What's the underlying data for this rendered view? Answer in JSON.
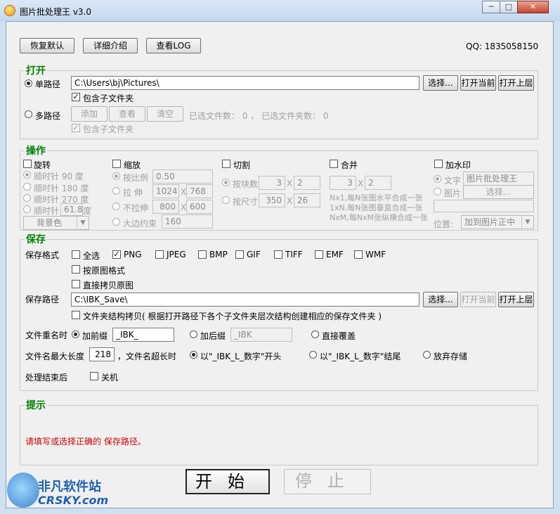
{
  "window": {
    "title": "图片批处理王 v3.0",
    "min": "─",
    "max": "□",
    "close": "✕"
  },
  "toolbar": {
    "reset": "恢复默认",
    "details": "详细介绍",
    "log": "查看LOG",
    "qq": "QQ: 1835058150"
  },
  "open": {
    "title": "打开",
    "single_path_label": "单路径",
    "single_path_value": "C:\\Users\\bj\\Pictures\\",
    "choose": "选择...",
    "open_current": "打开当前",
    "open_parent": "打开上层",
    "include_sub": "包含子文件夹",
    "multi_path_label": "多路径",
    "add": "添加",
    "view": "查看",
    "clear": "清空",
    "files_selected": "已选文件数：  0  ，  已选文件夹数：  0",
    "include_sub2": "包含子文件夹"
  },
  "ops": {
    "title": "操作",
    "rotate": {
      "label": "旋转",
      "cw90": "顺时针   90  度",
      "cw180": "顺时针  180  度",
      "cw270": "顺时针  270  度",
      "cw": "顺时针",
      "custom": "61.8",
      "deg": "度",
      "bg": "背景色"
    },
    "scale": {
      "label": "缩放",
      "ratio": "按比例",
      "ratio_val": "0.50",
      "stretch": "拉   伸",
      "w1": "1024",
      "h1": "768",
      "nostretch": "不拉伸",
      "w2": "800",
      "h2": "600",
      "x": "X",
      "edge": "大边约束",
      "edge_val": "160"
    },
    "cut": {
      "label": "切割",
      "by_count": "按块数",
      "c1": "3",
      "c2": "2",
      "by_size": "按尺寸",
      "s1": "350",
      "s2": "26",
      "x": "X"
    },
    "merge": {
      "label": "合并",
      "m1": "3",
      "m2": "2",
      "x": "X",
      "line1": "Nx1,每N张图水平合成一张",
      "line2": "1xN,每N张图垂直合成一张",
      "line3": "NxM,每NxM张纵横合成一张"
    },
    "watermark": {
      "label": "加水印",
      "text": "文字",
      "text_val": "图片批处理王",
      "image": "图片",
      "choose": "选择...",
      "position": "位置:",
      "pos_val": "加到图片正中"
    }
  },
  "save": {
    "title": "保存",
    "format_label": "保存格式",
    "formats": [
      "全选",
      "PNG",
      "JPEG",
      "BMP",
      "GIF",
      "TIFF",
      "EMF",
      "WMF"
    ],
    "keep_format": "按原图格式",
    "copy_original": "直接拷贝原图",
    "path_label": "保存路径",
    "path_value": "C:\\IBK_Save\\",
    "choose": "选择...",
    "open_current": "打开当前",
    "open_parent": "打开上层",
    "folder_struct": "文件夹结构拷贝( 根据打开路径下各个子文件夹层次结构创建相应的保存文件夹 )",
    "rename_label": "文件重名时",
    "prefix": "加前缀",
    "prefix_val": "_IBK_",
    "suffix": "加后缀",
    "suffix_val": "_IBK",
    "overwrite": "直接覆盖",
    "maxlen_label": "文件名最大长度",
    "maxlen_val": "218",
    "overlen": "，文件名超长时",
    "opt1": "以\"_IBK_L_数字\"开头",
    "opt2": "以\"_IBK_L_数字\"结尾",
    "opt3": "放弃存储",
    "after_label": "处理结束后",
    "shutdown": "关机"
  },
  "hint": {
    "title": "提示",
    "message": "请填写或选择正确的  保存路径。"
  },
  "actions": {
    "start": "开始",
    "stop": "停止"
  },
  "watermark_logo": {
    "cn": "非凡软件站",
    "en": "CRSKY.com"
  }
}
